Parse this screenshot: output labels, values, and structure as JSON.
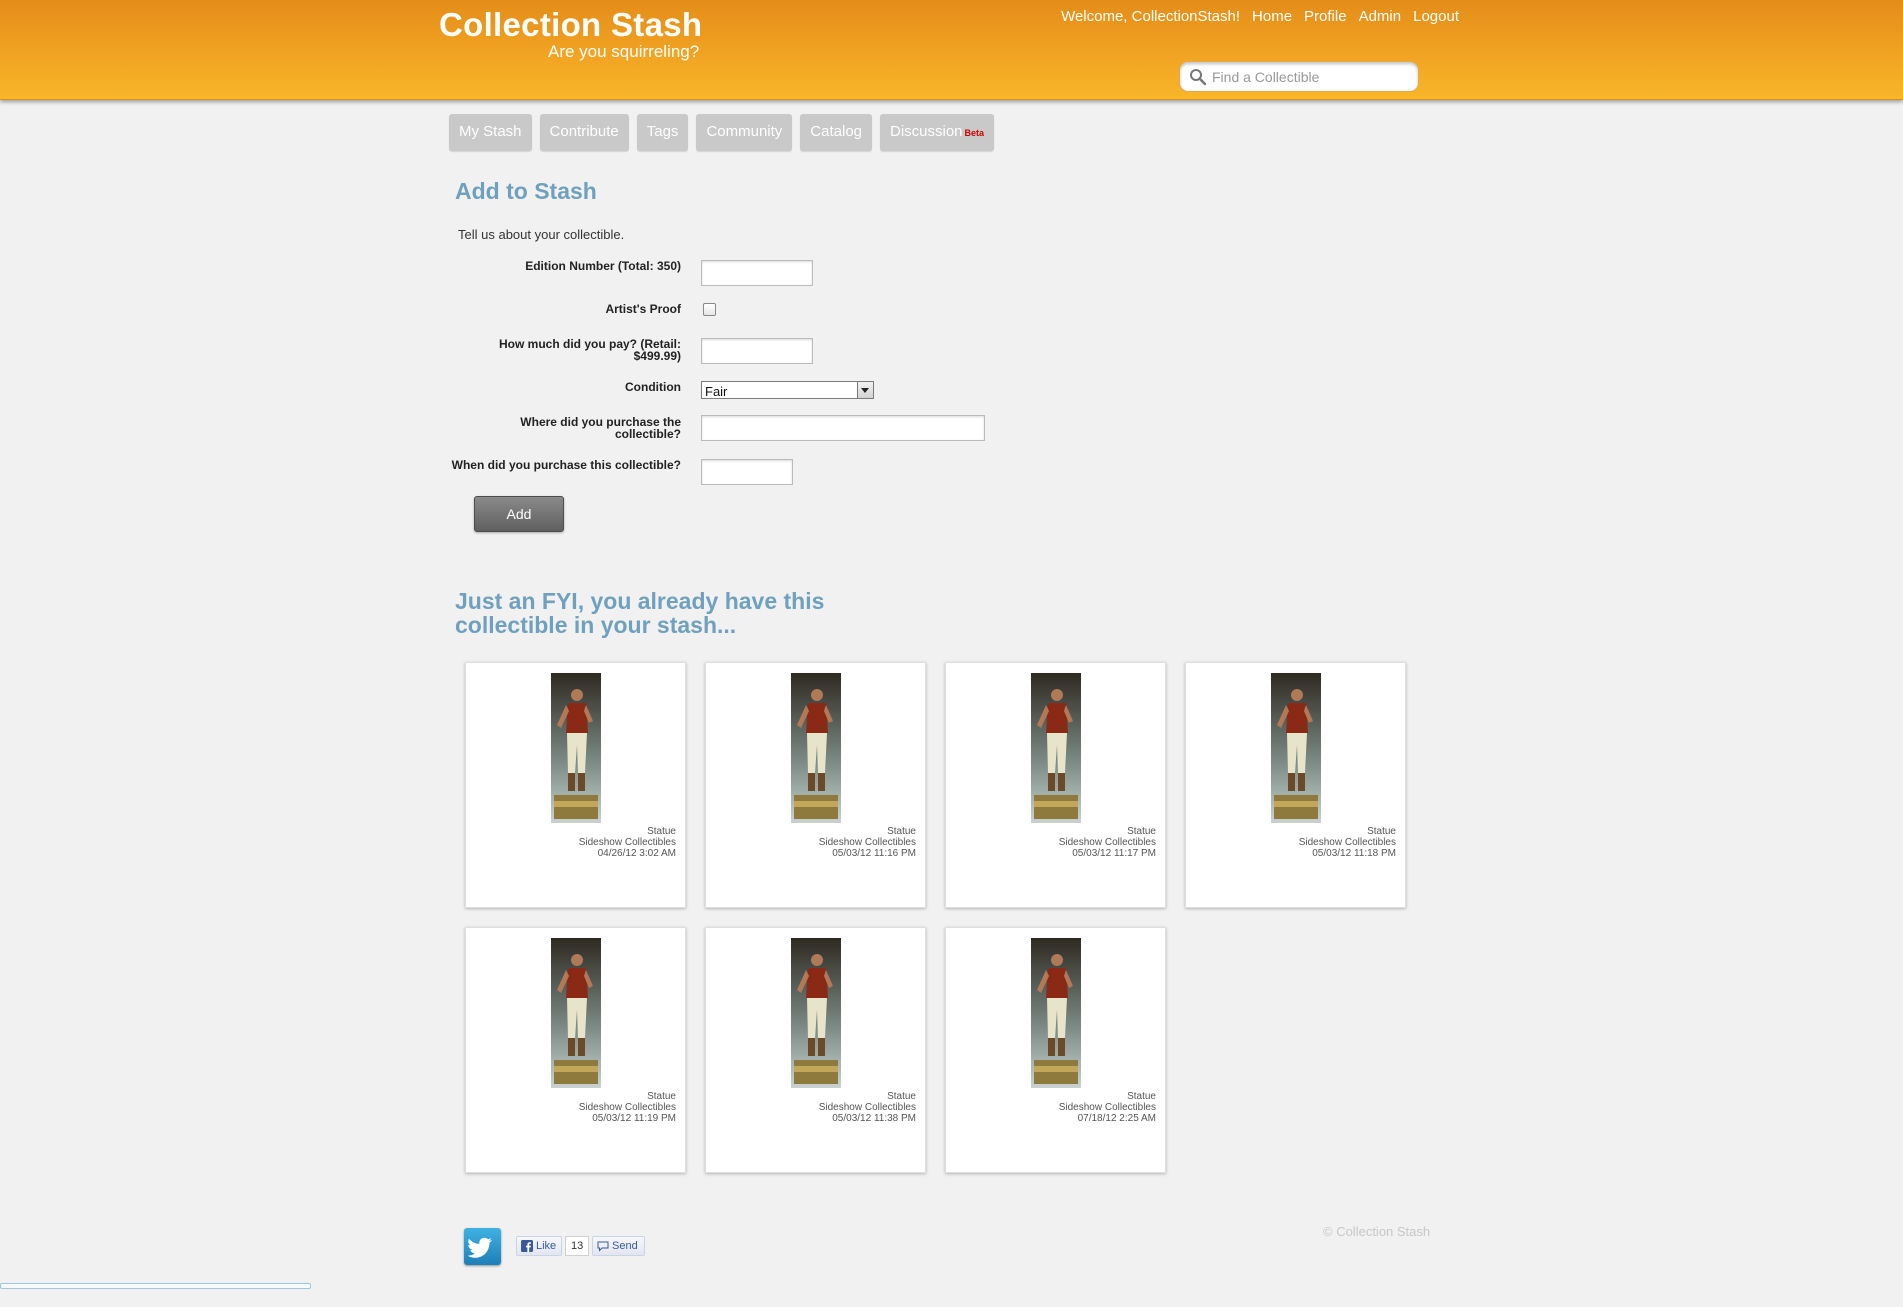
{
  "header": {
    "title": "Collection Stash",
    "tagline": "Are you squirreling?",
    "welcome": "Welcome, CollectionStash!",
    "links": [
      "Home",
      "Profile",
      "Admin",
      "Logout"
    ],
    "search_placeholder": "Find a Collectible"
  },
  "nav": {
    "tabs": [
      "My Stash",
      "Contribute",
      "Tags",
      "Community",
      "Catalog",
      "Discussion"
    ],
    "beta_badge": "Beta"
  },
  "form": {
    "title": "Add to Stash",
    "intro": "Tell us about your collectible.",
    "edition_label": "Edition Number (Total: 350)",
    "artist_proof_label": "Artist's Proof",
    "price_label": "How much did you pay? (Retail: $499.99)",
    "condition_label": "Condition",
    "condition_value": "Fair",
    "where_label": "Where did you purchase the collectible?",
    "when_label": "When did you purchase this collectible?",
    "add_button": "Add"
  },
  "fyi": {
    "title": "Just an FYI, you already have this collectible in your stash...",
    "items": [
      {
        "type": "Statue",
        "maker": "Sideshow Collectibles",
        "date": "04/26/12 3:02 AM"
      },
      {
        "type": "Statue",
        "maker": "Sideshow Collectibles",
        "date": "05/03/12 11:16 PM"
      },
      {
        "type": "Statue",
        "maker": "Sideshow Collectibles",
        "date": "05/03/12 11:17 PM"
      },
      {
        "type": "Statue",
        "maker": "Sideshow Collectibles",
        "date": "05/03/12 11:18 PM"
      },
      {
        "type": "Statue",
        "maker": "Sideshow Collectibles",
        "date": "05/03/12 11:19 PM"
      },
      {
        "type": "Statue",
        "maker": "Sideshow Collectibles",
        "date": "05/03/12 11:38 PM"
      },
      {
        "type": "Statue",
        "maker": "Sideshow Collectibles",
        "date": "07/18/12 2:25 AM"
      }
    ]
  },
  "footer": {
    "like_label": "Like",
    "like_count": "13",
    "send_label": "Send",
    "copyright": "© Collection Stash"
  },
  "colors": {
    "header_orange": "#f1a322",
    "heading_blue": "#6fa0bd",
    "tab_gray": "#c9c9c9"
  }
}
